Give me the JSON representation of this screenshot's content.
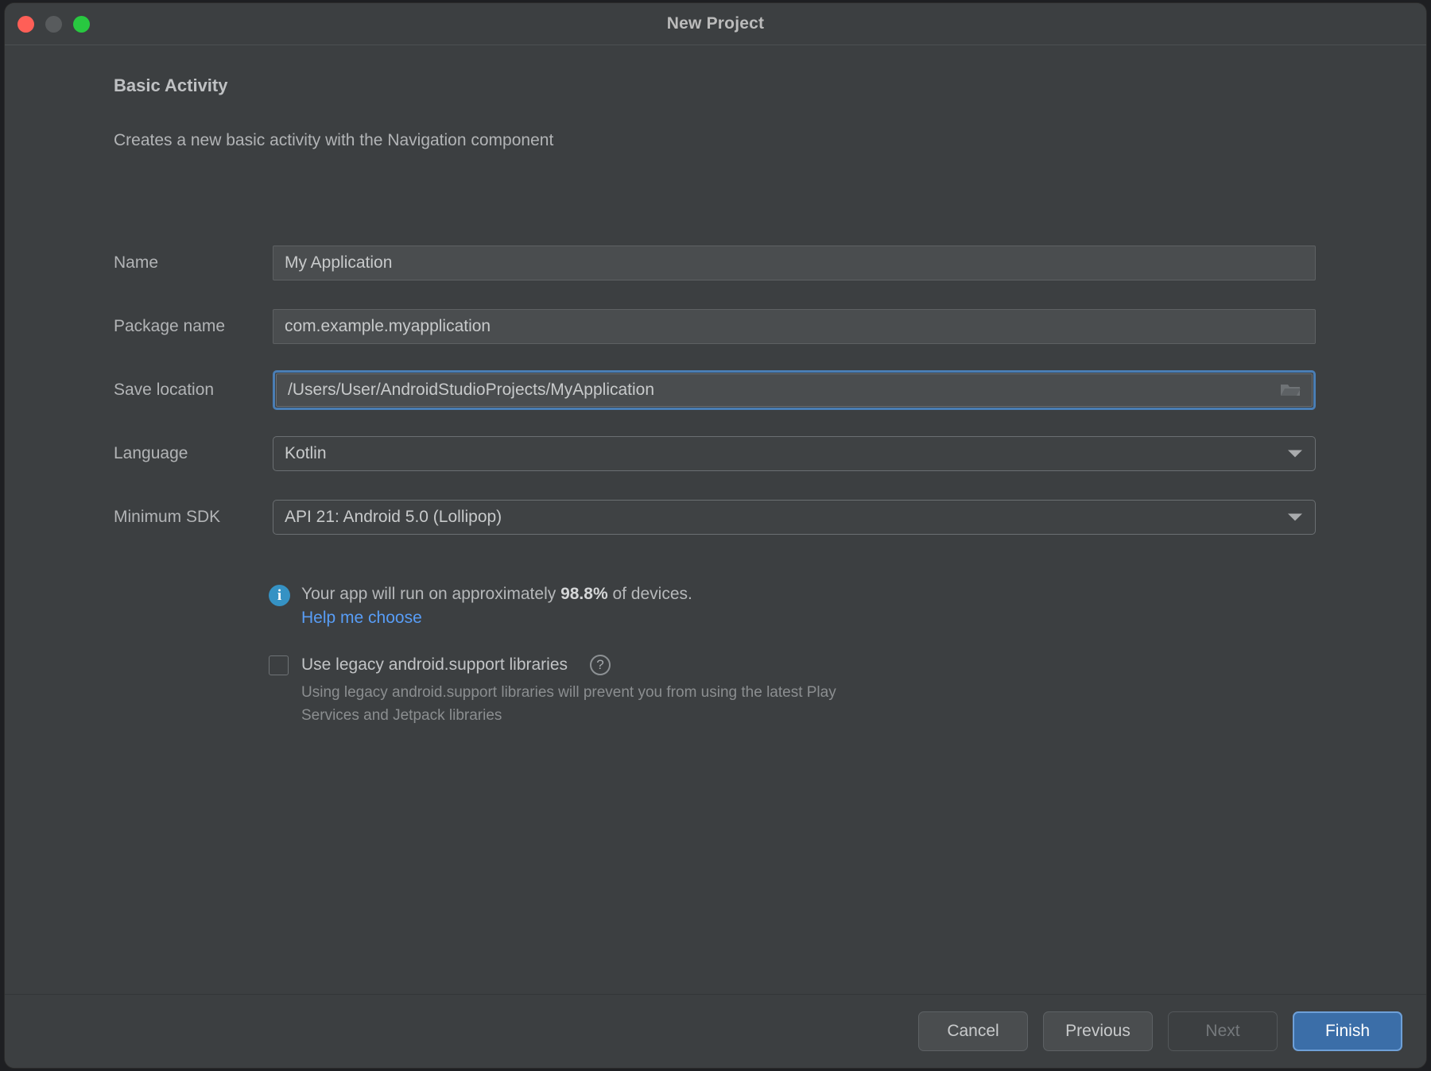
{
  "window": {
    "title": "New Project",
    "traffic_lights": [
      "close",
      "minimize",
      "zoom"
    ]
  },
  "main": {
    "heading": "Basic Activity",
    "subheading": "Creates a new basic activity with the Navigation component",
    "fields": [
      {
        "label": "Name",
        "value": "My Application",
        "type": "text"
      },
      {
        "label": "Package name",
        "value": "com.example.myapplication",
        "type": "text"
      },
      {
        "label": "Save location",
        "value": "/Users/User/AndroidStudioProjects/MyApplication",
        "type": "text-browse",
        "focused": true
      },
      {
        "label": "Language",
        "value": "Kotlin",
        "type": "select"
      },
      {
        "label": "Minimum SDK",
        "value": "API 21: Android 5.0 (Lollipop)",
        "type": "select"
      }
    ],
    "info": {
      "icon": "info-icon",
      "text_before": "Your app will run on approximately ",
      "percent": "98.8%",
      "text_after": " of devices.",
      "link": "Help me choose"
    },
    "legacy": {
      "checked": false,
      "label": "Use legacy android.support libraries",
      "help_glyph": "?",
      "description": "Using legacy android.support libraries will prevent you from using the latest Play Services and Jetpack libraries"
    }
  },
  "footer": {
    "buttons": [
      {
        "label": "Cancel",
        "state": "normal"
      },
      {
        "label": "Previous",
        "state": "normal"
      },
      {
        "label": "Next",
        "state": "disabled"
      },
      {
        "label": "Finish",
        "state": "primary"
      }
    ]
  },
  "colors": {
    "window_bg": "#3c3f41",
    "accent_blue": "#3b6ea8",
    "focus_ring": "#4a7eb5",
    "link_blue": "#589df6",
    "info_blue": "#3592c4",
    "close_red": "#ff5f57",
    "minimize_gray": "#585b5d",
    "zoom_green": "#28c840"
  }
}
